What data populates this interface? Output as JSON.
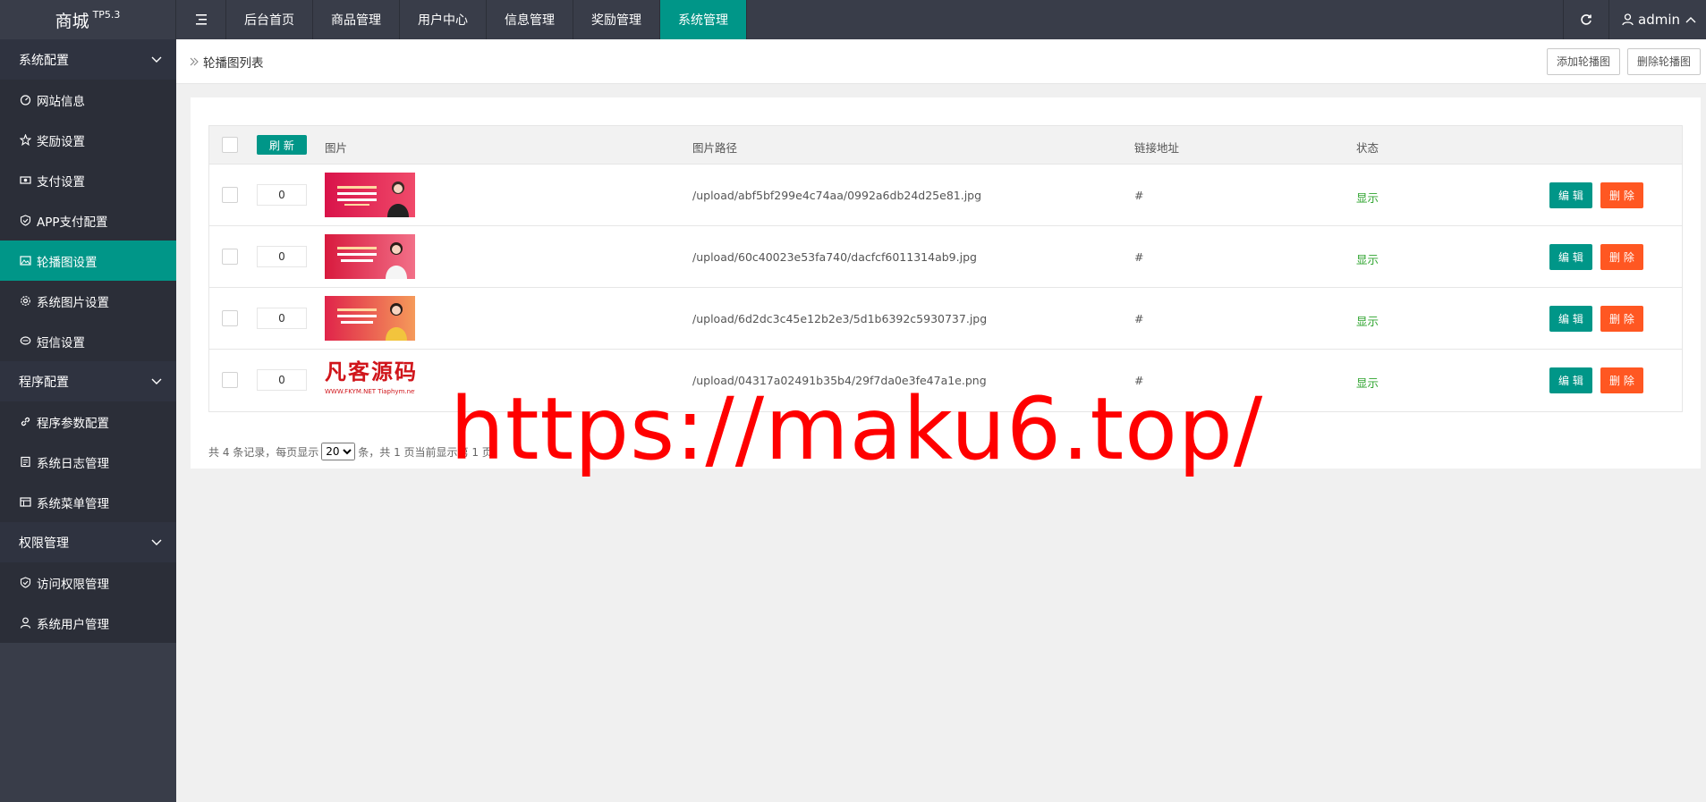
{
  "app": {
    "logo": "商城",
    "version": "TP5.3"
  },
  "topnav": [
    {
      "label": "后台首页",
      "active": false
    },
    {
      "label": "商品管理",
      "active": false
    },
    {
      "label": "用户中心",
      "active": false
    },
    {
      "label": "信息管理",
      "active": false
    },
    {
      "label": "奖励管理",
      "active": false
    },
    {
      "label": "系统管理",
      "active": true
    }
  ],
  "user": {
    "name": "admin"
  },
  "sidebar": {
    "group1": "系统配置",
    "group1_items": [
      "网站信息",
      "奖励设置",
      "支付设置",
      "APP支付配置",
      "轮播图设置",
      "系统图片设置",
      "短信设置"
    ],
    "group2": "程序配置",
    "group2_items": [
      "程序参数配置",
      "系统日志管理",
      "系统菜单管理"
    ],
    "group3": "权限管理",
    "group3_items": [
      "访问权限管理",
      "系统用户管理"
    ]
  },
  "breadcrumb": {
    "title": "轮播图列表"
  },
  "actions": {
    "add": "添加轮播图",
    "delete": "删除轮播图"
  },
  "table": {
    "refresh": "刷 新",
    "headers": {
      "image": "图片",
      "path": "图片路径",
      "link": "链接地址",
      "status": "状态"
    },
    "rows": [
      {
        "sort": "0",
        "path": "/upload/abf5bf299e4c74aa/0992a6db24d25e81.jpg",
        "link": "#",
        "status": "显示",
        "thumb_text": "客户至上 · 创新合作共赢 · 精准营销服务 · 共享发展"
      },
      {
        "sort": "0",
        "path": "/upload/60c40023e53fa740/dacfcf6011314ab9.jpg",
        "link": "#",
        "status": "显示",
        "thumb_text": "品质服务 · 用心做好每一件事 · 贴心关怀"
      },
      {
        "sort": "0",
        "path": "/upload/6d2dc3c45e12b2e3/5d1b6392c5930737.jpg",
        "link": "#",
        "status": "显示",
        "thumb_text": "携手同行 · 共创美好未来 · 共享成功"
      },
      {
        "sort": "0",
        "path": "/upload/04317a02491b35b4/29f7da0e3fe47a1e.png",
        "link": "#",
        "status": "显示",
        "thumb_text": "凡客源码",
        "thumb_sub": "WWW.FKYM.NET  Tiaphym.net"
      }
    ],
    "edit": "编 辑",
    "del": "删 除"
  },
  "pager": {
    "prefix": "共 4 条记录，每页显示",
    "per_page": "20",
    "suffix": "条，共 1 页当前显示第 1 页。"
  },
  "watermark": "https://maku6.top/"
}
